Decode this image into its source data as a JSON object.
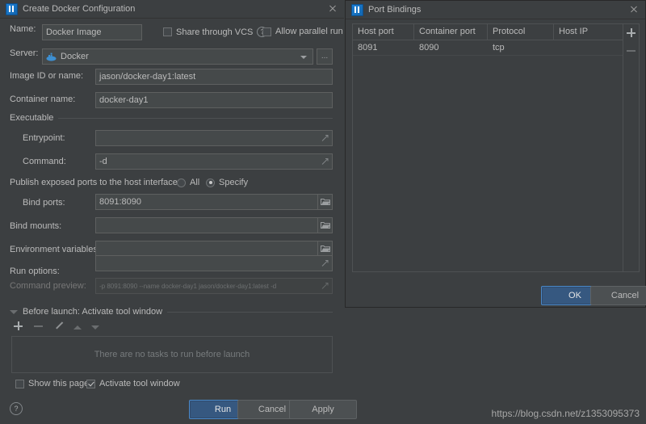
{
  "config_dialog": {
    "title": "Create Docker Configuration",
    "icon": "intellij-logo-icon",
    "close_icon": "close-icon",
    "name_label": "Name:",
    "name_value": "Docker Image",
    "share_vcs_label": "Share through VCS",
    "share_vcs_checked": false,
    "help_icon": "question-mark-icon",
    "allow_parallel_label": "Allow parallel run",
    "allow_parallel_checked": false,
    "server_label": "Server:",
    "server_value": "Docker",
    "server_icon": "docker-whale-icon",
    "server_browse_label": "...",
    "image_label": "Image ID or name:",
    "image_value": "jason/docker-day1:latest",
    "container_label": "Container name:",
    "container_value": "docker-day1",
    "executable_section": "Executable",
    "entrypoint_label": "Entrypoint:",
    "entrypoint_value": "",
    "command_label": "Command:",
    "command_value": "-d",
    "publish_label": "Publish exposed ports to the host interfaces:",
    "radio_all_label": "All",
    "radio_specify_label": "Specify",
    "ports_mode": "Specify",
    "bind_ports_label": "Bind ports:",
    "bind_ports_value": "8091:8090",
    "bind_mounts_label": "Bind mounts:",
    "bind_mounts_value": "",
    "env_vars_label": "Environment variables:",
    "env_vars_value": "",
    "run_options_label": "Run options:",
    "run_options_value": "",
    "command_preview_label": "Command preview:",
    "command_preview_value": "-p 8091:8090 --name docker-day1 jason/docker-day1:latest -d",
    "before_launch_title": "Before launch: Activate tool window",
    "before_launch_collapse_icon": "triangle-down-icon",
    "toolbar": {
      "add_icon": "plus-icon",
      "remove_icon": "minus-icon",
      "edit_icon": "pencil-icon",
      "move_up_icon": "arrow-up-icon",
      "move_down_icon": "arrow-down-icon"
    },
    "empty_tasks_text": "There are no tasks to run before launch",
    "show_page_label": "Show this page",
    "show_page_checked": false,
    "activate_tool_label": "Activate tool window",
    "activate_tool_checked": true,
    "footer": {
      "help_icon": "help-icon",
      "run_label": "Run",
      "cancel_label": "Cancel",
      "apply_label": "Apply"
    }
  },
  "ports_dialog": {
    "title": "Port Bindings",
    "icon": "intellij-logo-icon",
    "close_icon": "close-icon",
    "columns": [
      "Host port",
      "Container port",
      "Protocol",
      "Host IP"
    ],
    "rows": [
      {
        "host_port": "8091",
        "container_port": "8090",
        "protocol": "tcp",
        "host_ip": ""
      }
    ],
    "add_icon": "plus-icon",
    "remove_icon": "minus-icon",
    "ok_label": "OK",
    "cancel_label": "Cancel"
  },
  "watermark": "https://blog.csdn.net/z1353095373",
  "colors": {
    "background": "#3c3f41",
    "field_background": "#45494a",
    "accent_blue": "#365880",
    "border": "#5e6060",
    "text": "#bbbbbb",
    "text_dim": "#777777"
  }
}
